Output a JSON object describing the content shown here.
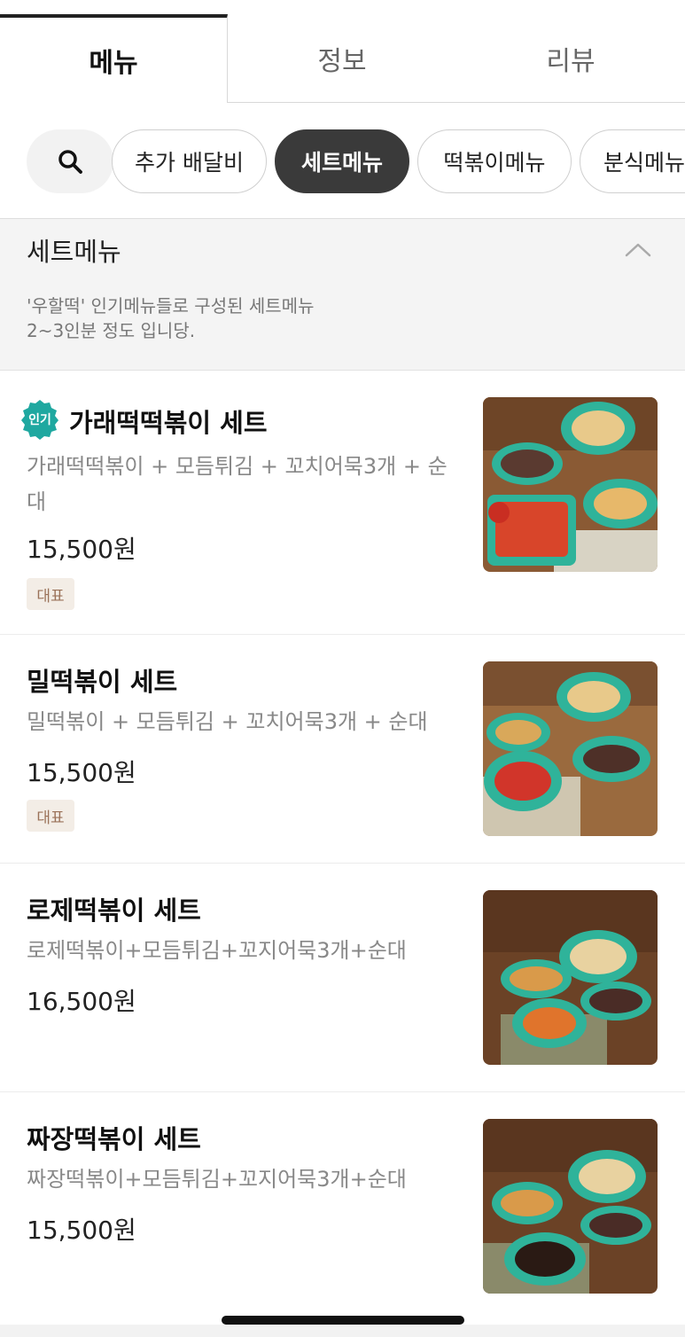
{
  "tabs": [
    {
      "label": "메뉴",
      "active": true
    },
    {
      "label": "정보",
      "active": false
    },
    {
      "label": "리뷰",
      "active": false
    }
  ],
  "search": {
    "icon": "search-icon"
  },
  "chips": [
    {
      "label": "추가 배달비",
      "active": false
    },
    {
      "label": "세트메뉴",
      "active": true
    },
    {
      "label": "떡볶이메뉴",
      "active": false
    },
    {
      "label": "분식메뉴",
      "active": false
    }
  ],
  "section": {
    "title": "세트메뉴",
    "collapse_icon": "chevron-up-icon",
    "description_lines": [
      "'우할떡' 인기메뉴들로 구성된 세트메뉴",
      "2~3인분 정도 입니당."
    ]
  },
  "items": [
    {
      "popular_badge": "인기",
      "name": "가래떡떡볶이 세트",
      "description": "가래떡떡볶이 + 모듬튀김 + 꼬치어묵3개 + 순대",
      "price": "15,500원",
      "tag": "대표"
    },
    {
      "name": "밀떡볶이 세트",
      "description": "밀떡볶이 + 모듬튀김 + 꼬치어묵3개 + 순대",
      "price": "15,500원",
      "tag": "대표"
    },
    {
      "name": "로제떡볶이 세트",
      "description": "로제떡볶이+모듬튀김+꼬지어묵3개+순대",
      "price": "16,500원"
    },
    {
      "name": "짜장떡볶이 세트",
      "description": "짜장떡볶이+모듬튀김+꼬지어묵3개+순대",
      "price": "15,500원"
    }
  ],
  "colors": {
    "active_chip": "#3a3a3a",
    "popular_badge": "#1fa8a0",
    "tag_bg": "#f3ede6",
    "tag_text": "#9a7158"
  }
}
